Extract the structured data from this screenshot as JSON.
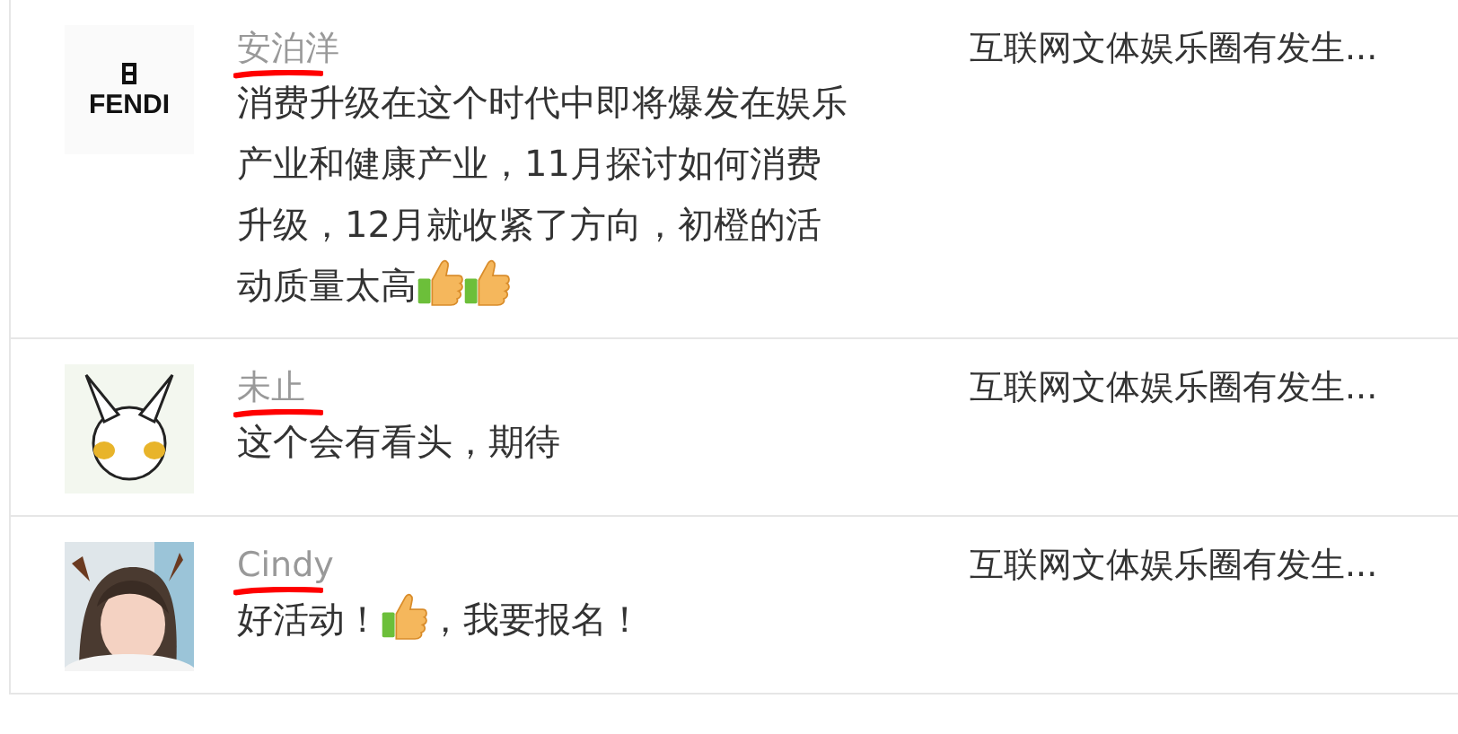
{
  "comments": [
    {
      "avatar": {
        "kind": "logo",
        "text": "FENDI"
      },
      "name": "安泊洋",
      "redacted": true,
      "content": [
        {
          "kind": "text",
          "text": "消费升级在这个时代中即将爆发在娱乐产业和健康产业，11月探讨如何消费升级，12月就收紧了方向，初橙的活动质量太高"
        },
        {
          "kind": "thumb"
        },
        {
          "kind": "thumb"
        }
      ],
      "topic": "互联网文体娱乐圈有发生..."
    },
    {
      "avatar": {
        "kind": "cartoon"
      },
      "name": "未止",
      "redacted": true,
      "content": [
        {
          "kind": "text",
          "text": "这个会有看头，期待"
        }
      ],
      "topic": "互联网文体娱乐圈有发生..."
    },
    {
      "name": "Cindy",
      "redacted": true,
      "content": [
        {
          "kind": "text",
          "text": "好活动！"
        },
        {
          "kind": "thumb"
        },
        {
          "kind": "text",
          "text": "，我要报名！"
        }
      ],
      "topic": "互联网文体娱乐圈有发生..."
    }
  ]
}
